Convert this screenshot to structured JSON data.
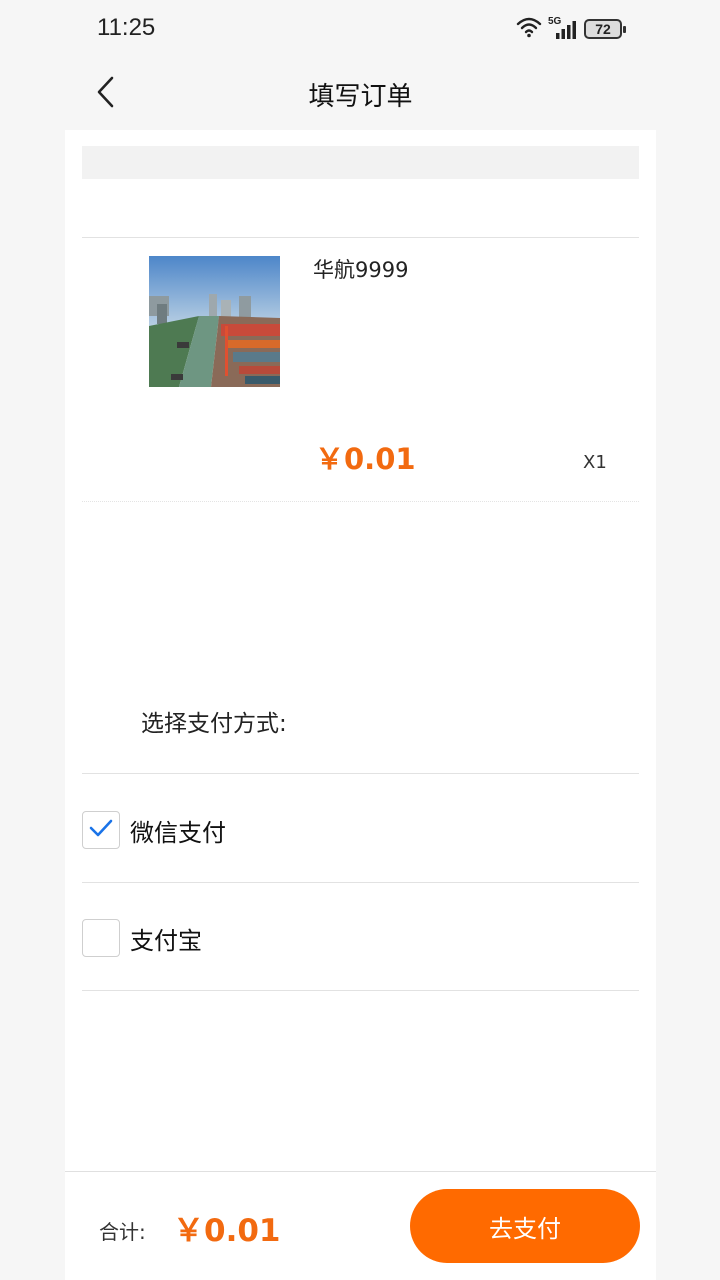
{
  "status_bar": {
    "time": "11:25",
    "network": "5G",
    "battery": "72"
  },
  "header": {
    "title": "填写订单",
    "back_icon": "chevron-left-icon"
  },
  "product": {
    "name": "华航9999",
    "price": "￥0.01",
    "quantity": "X1",
    "image_icon": "port-photo"
  },
  "payment": {
    "title": "选择支付方式:",
    "options": [
      {
        "label": "微信支付",
        "checked": true
      },
      {
        "label": "支付宝",
        "checked": false
      }
    ]
  },
  "footer": {
    "total_label": "合计:",
    "total_value": "￥0.01",
    "pay_button": "去支付"
  },
  "colors": {
    "accent": "#ff6a00",
    "price": "#f26a10",
    "check": "#1a73e8"
  }
}
